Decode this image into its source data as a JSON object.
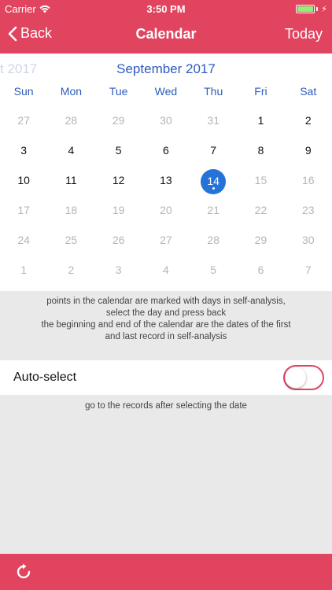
{
  "status": {
    "carrier": "Carrier",
    "time": "3:50 PM"
  },
  "nav": {
    "back_label": "Back",
    "title": "Calendar",
    "today_label": "Today"
  },
  "calendar": {
    "prev_month_label": "t 2017",
    "month_label": "September 2017",
    "weekdays": [
      "Sun",
      "Mon",
      "Tue",
      "Wed",
      "Thu",
      "Fri",
      "Sat"
    ],
    "weeks": [
      [
        {
          "d": "27",
          "muted": true
        },
        {
          "d": "28",
          "muted": true
        },
        {
          "d": "29",
          "muted": true
        },
        {
          "d": "30",
          "muted": true
        },
        {
          "d": "31",
          "muted": true
        },
        {
          "d": "1"
        },
        {
          "d": "2"
        }
      ],
      [
        {
          "d": "3"
        },
        {
          "d": "4"
        },
        {
          "d": "5"
        },
        {
          "d": "6"
        },
        {
          "d": "7"
        },
        {
          "d": "8"
        },
        {
          "d": "9"
        }
      ],
      [
        {
          "d": "10"
        },
        {
          "d": "11"
        },
        {
          "d": "12"
        },
        {
          "d": "13"
        },
        {
          "d": "14",
          "selected": true,
          "dot": true
        },
        {
          "d": "15",
          "muted": true
        },
        {
          "d": "16",
          "muted": true
        }
      ],
      [
        {
          "d": "17",
          "muted": true
        },
        {
          "d": "18",
          "muted": true
        },
        {
          "d": "19",
          "muted": true
        },
        {
          "d": "20",
          "muted": true
        },
        {
          "d": "21",
          "muted": true
        },
        {
          "d": "22",
          "muted": true
        },
        {
          "d": "23",
          "muted": true
        }
      ],
      [
        {
          "d": "24",
          "muted": true
        },
        {
          "d": "25",
          "muted": true
        },
        {
          "d": "26",
          "muted": true
        },
        {
          "d": "27",
          "muted": true
        },
        {
          "d": "28",
          "muted": true
        },
        {
          "d": "29",
          "muted": true
        },
        {
          "d": "30",
          "muted": true
        }
      ],
      [
        {
          "d": "1",
          "muted": true
        },
        {
          "d": "2",
          "muted": true
        },
        {
          "d": "3",
          "muted": true
        },
        {
          "d": "4",
          "muted": true
        },
        {
          "d": "5",
          "muted": true
        },
        {
          "d": "6",
          "muted": true
        },
        {
          "d": "7",
          "muted": true
        }
      ]
    ]
  },
  "info": {
    "line1": "points in the calendar are marked with days in self-analysis,",
    "line2": "select the day and press back",
    "line3": "the beginning and end of the calendar are the dates of the first",
    "line4": "and last record in self-analysis"
  },
  "auto_select": {
    "label": "Auto-select",
    "enabled": false
  },
  "hint": "go to the records after selecting the date",
  "colors": {
    "accent": "#e0445e",
    "blue": "#2d5bbd",
    "selected": "#2673d8"
  },
  "icons": {
    "back": "chevron-left-icon",
    "refresh": "refresh-icon",
    "wifi": "wifi-icon",
    "battery": "battery-icon"
  }
}
